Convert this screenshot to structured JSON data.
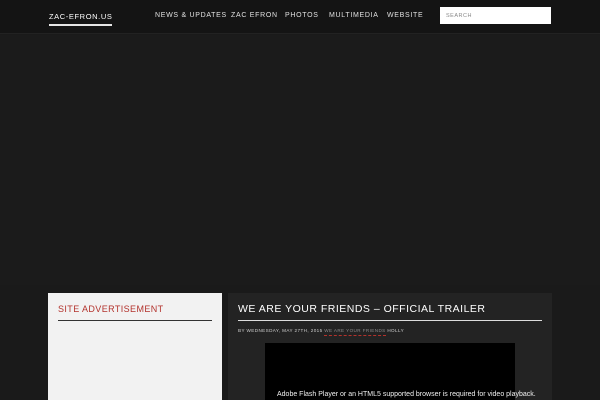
{
  "header": {
    "brand": "ZAC-EFRON.US",
    "nav": [
      "NEWS & UPDATES",
      "ZAC EFRON",
      "PHOTOS",
      "MULTIMEDIA",
      "WEBSITE"
    ],
    "search_placeholder": "SEARCH"
  },
  "sidebar": {
    "title": "SITE ADVERTISEMENT"
  },
  "post": {
    "title": "WE ARE YOUR FRIENDS – OFFICIAL TRAILER",
    "meta_prefix": "BY WEDNESDAY, MAY 27TH, 2015",
    "category": "WE ARE YOUR FRIENDS",
    "meta_author": "HOLLY",
    "video_message": "Adobe Flash Player or an HTML5 supported browser is required for video playback."
  },
  "colors": {
    "accent": "#b3322c",
    "background": "#1a1a1a",
    "topbar": "#141414",
    "panel_dark": "#232323",
    "panel_light": "#f2f2f2"
  }
}
